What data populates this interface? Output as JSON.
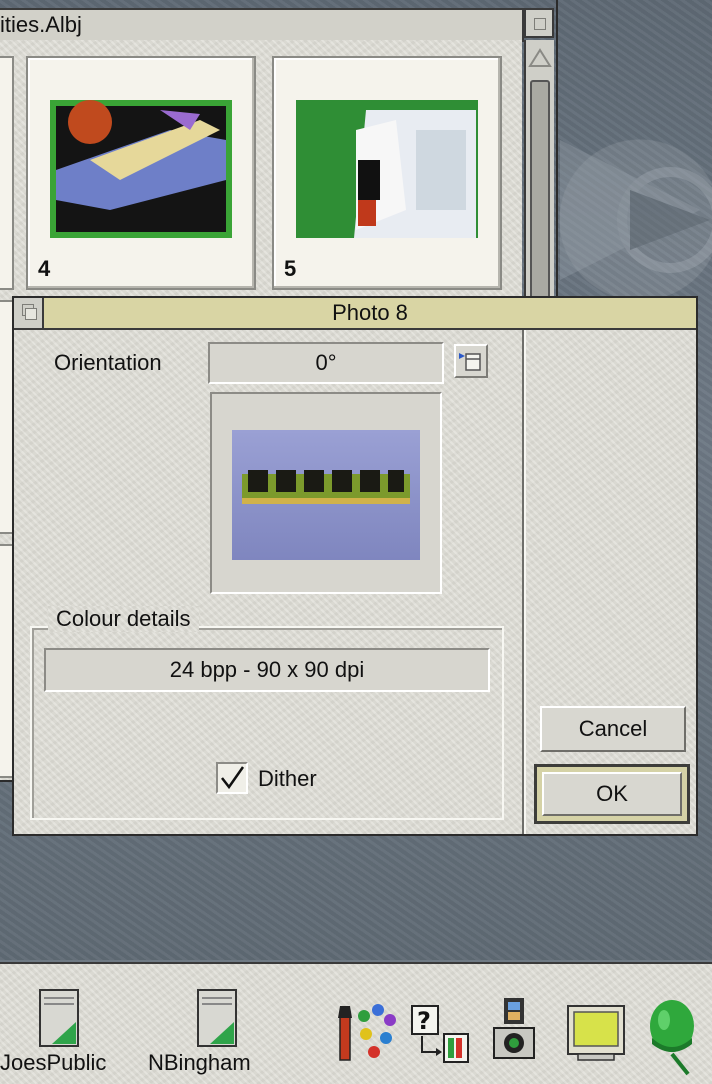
{
  "album": {
    "title": "ities.Albj",
    "thumbnails": [
      {
        "number": "4"
      },
      {
        "number": "5"
      }
    ]
  },
  "dialog": {
    "title": "Photo 8",
    "orientation_label": "Orientation",
    "orientation_value": "0°",
    "colour_group_label": "Colour details",
    "colour_details": "24 bpp - 90 x 90 dpi",
    "dither_label": "Dither",
    "dither_checked": true,
    "cancel_label": "Cancel",
    "ok_label": "OK"
  },
  "iconbar": {
    "items": [
      {
        "label": "JoesPublic",
        "icon": "harddisc-icon"
      },
      {
        "label": "NBingham",
        "icon": "harddisc-icon"
      },
      {
        "label": "",
        "icon": "paint-palette-icon"
      },
      {
        "label": "",
        "icon": "help-icon"
      },
      {
        "label": "",
        "icon": "camera-film-icon"
      },
      {
        "label": "",
        "icon": "monitor-icon"
      },
      {
        "label": "",
        "icon": "acorn-icon"
      }
    ]
  },
  "colors": {
    "window_face": "#dcdbd4",
    "dialog_title_bg": "#d9d5a4",
    "desktop": "#6f7a84"
  }
}
